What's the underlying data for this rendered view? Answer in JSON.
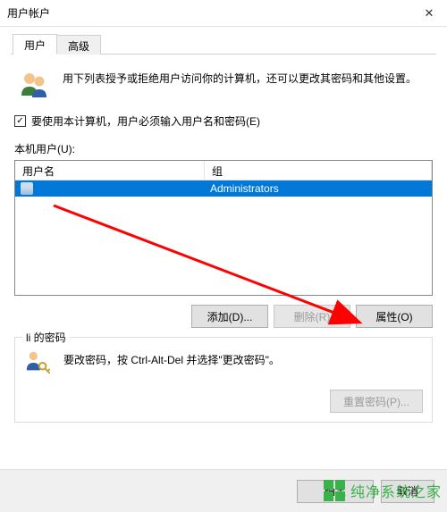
{
  "window": {
    "title": "用户帐户",
    "close_icon": "✕"
  },
  "tabs": {
    "user": "用户",
    "advanced": "高级"
  },
  "intro": {
    "text": "用下列表授予或拒绝用户访问你的计算机，还可以更改其密码和其他设置。"
  },
  "checkbox": {
    "checked_mark": "✓",
    "label": "要使用本计算机，用户必须输入用户名和密码(E)"
  },
  "users_section_label": "本机用户(U):",
  "table": {
    "header_user": "用户名",
    "header_group": "组",
    "rows": [
      {
        "user": "",
        "group": "Administrators"
      }
    ]
  },
  "buttons": {
    "add": "添加(D)...",
    "remove": "删除(R)",
    "properties": "属性(O)"
  },
  "password_group": {
    "title": "li 的密码",
    "text": "要改密码，按 Ctrl-Alt-Del 并选择\"更改密码\"。",
    "reset_btn": "重置密码(P)..."
  },
  "dialog_buttons": {
    "ok": "确定",
    "cancel": "取消"
  },
  "watermark": {
    "text": "纯净系统之家",
    "url_hint": "ycwsjj.com"
  },
  "annotation": {
    "color": "#ff0000"
  }
}
